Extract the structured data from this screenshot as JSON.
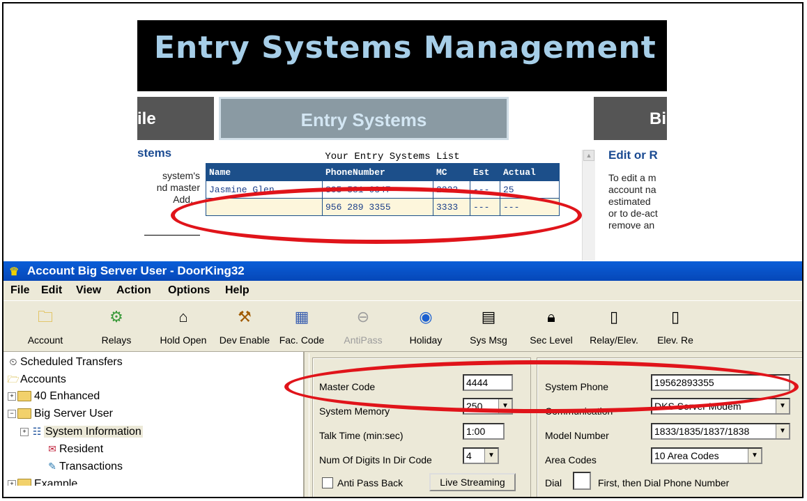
{
  "web": {
    "banner_title": "Entry Systems Management",
    "tabs": {
      "left": "ile",
      "middle": "Entry Systems",
      "right": "Bi"
    },
    "left_panel": {
      "heading": "stems",
      "lines": [
        "system's",
        "nd master",
        "Add."
      ]
    },
    "right_panel": {
      "heading": "Edit or R",
      "lines": [
        "To edit a m",
        "account na",
        "estimated",
        "or to de-act",
        "remove an"
      ]
    },
    "list_caption": "Your Entry Systems List",
    "columns": [
      "Name",
      "PhoneNumber",
      "MC",
      "Est",
      "Actual"
    ],
    "rows": [
      [
        "Jasmine Glen",
        "805 581 6347",
        "2222",
        "---",
        "25"
      ],
      [
        "",
        "956 289 3355",
        "3333",
        "---",
        "---"
      ]
    ]
  },
  "app": {
    "title": "Account Big Server User - DoorKing32",
    "menu": [
      "File",
      "Edit",
      "View",
      "Action",
      "Options",
      "Help"
    ],
    "toolbar": [
      {
        "label": "Account",
        "icon": "folder-icon"
      },
      {
        "label": "Relays",
        "icon": "relays-icon"
      },
      {
        "label": "Hold Open",
        "icon": "door-icon"
      },
      {
        "label": "Dev Enable",
        "icon": "device-icon"
      },
      {
        "label": "Fac. Code",
        "icon": "facility-code-icon"
      },
      {
        "label": "AntiPass",
        "icon": "antipass-icon",
        "disabled": true
      },
      {
        "label": "Holiday",
        "icon": "globe-icon"
      },
      {
        "label": "Sys Msg",
        "icon": "keypad-icon"
      },
      {
        "label": "Sec Level",
        "icon": "lock-icon"
      },
      {
        "label": "Relay/Elev.",
        "icon": "elevator-icon"
      },
      {
        "label": "Elev. Re",
        "icon": "elevator-icon"
      }
    ],
    "tree": {
      "scheduled": "Scheduled Transfers",
      "accounts": "Accounts",
      "enhanced": "40 Enhanced",
      "big_server": "Big Server User",
      "system_info": "System Information",
      "resident": "Resident",
      "transactions": "Transactions",
      "example": "Example"
    },
    "form": {
      "master_code_label": "Master Code",
      "master_code": "4444",
      "system_memory_label": "System Memory",
      "system_memory": "250",
      "talk_time_label": "Talk Time (min:sec)",
      "talk_time": "1:00",
      "digits_label": "Num Of Digits In Dir Code",
      "digits": "4",
      "anti_pass_label": "Anti Pass Back",
      "live_streaming": "Live Streaming",
      "system_phone_label": "System Phone",
      "system_phone": "19562893355",
      "communication_label": "Communication",
      "communication": "DKS Server Modem",
      "model_label": "Model Number",
      "model": "1833/1835/1837/1838",
      "area_codes_label": "Area Codes",
      "area_codes": "10 Area Codes",
      "dial_label": "Dial",
      "dial_suffix": "First, then Dial Phone Number"
    }
  }
}
